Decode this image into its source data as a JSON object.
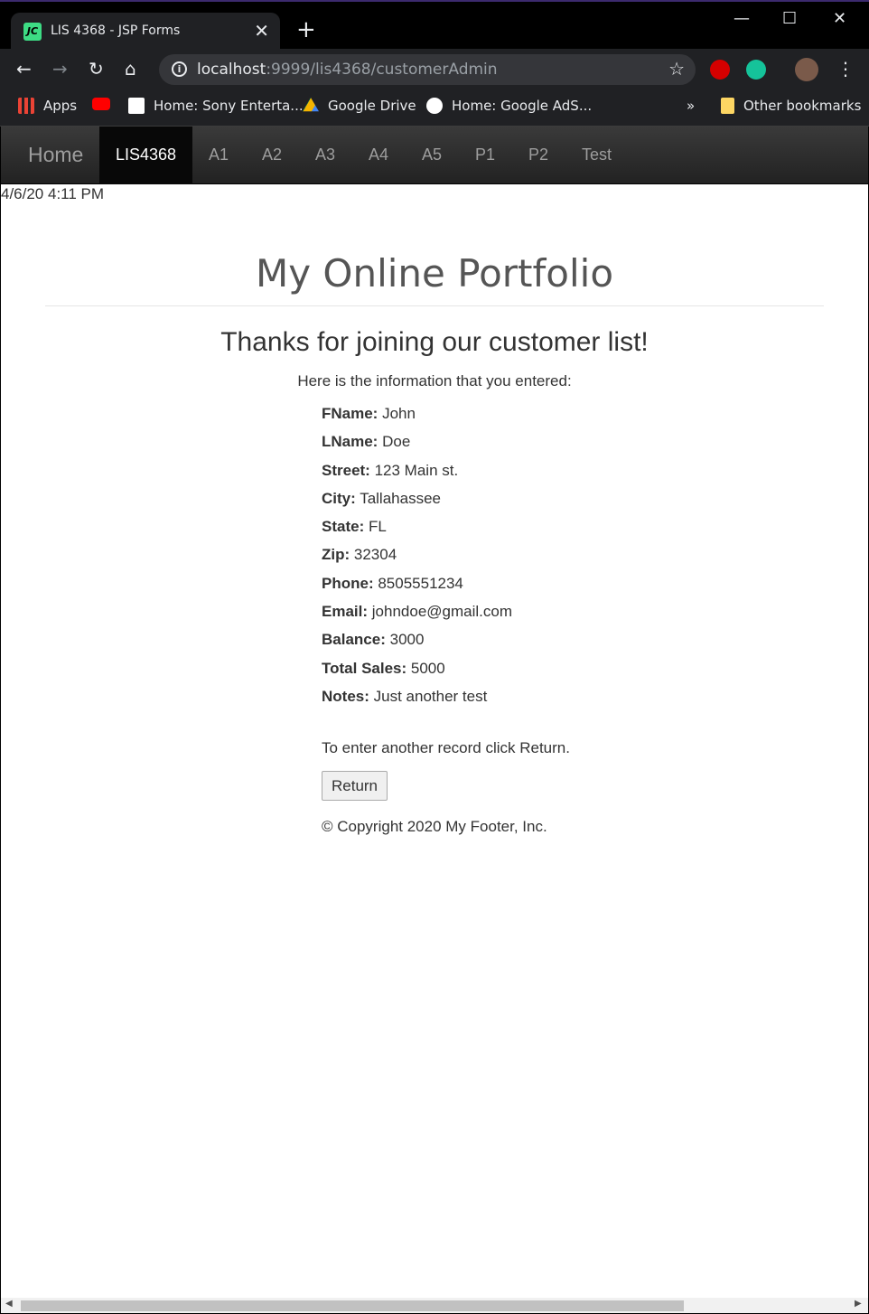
{
  "browser": {
    "tab_title": "LIS 4368 - JSP Forms",
    "tab_favicon_text": "JC",
    "url_host": "localhost",
    "url_path": ":9999/lis4368/customerAdmin",
    "bookmarks": [
      {
        "label": "Apps",
        "icon": "apps-grid-icon"
      },
      {
        "label": "",
        "icon": "youtube-icon"
      },
      {
        "label": "Home: Sony Enterta...",
        "icon": "sony-s-icon"
      },
      {
        "label": "Google Drive",
        "icon": "google-drive-icon"
      },
      {
        "label": "Home: Google AdS...",
        "icon": "google-g-icon"
      }
    ],
    "overflow_chevron": "»",
    "other_bookmarks": "Other bookmarks"
  },
  "nav": {
    "brand": "Home",
    "items": [
      "LIS4368",
      "A1",
      "A2",
      "A3",
      "A4",
      "A5",
      "P1",
      "P2",
      "Test"
    ],
    "active_item": "LIS4368"
  },
  "page": {
    "timestamp": "4/6/20 4:11 PM",
    "heading": "My Online Portfolio",
    "thanks": "Thanks for joining our customer list!",
    "intro": "Here is the information that you entered:",
    "fields": [
      {
        "label": "FName:",
        "value": "John"
      },
      {
        "label": "LName:",
        "value": "Doe"
      },
      {
        "label": "Street:",
        "value": "123 Main st."
      },
      {
        "label": "City:",
        "value": "Tallahassee"
      },
      {
        "label": "State:",
        "value": "FL"
      },
      {
        "label": "Zip:",
        "value": "32304"
      },
      {
        "label": "Phone:",
        "value": "8505551234"
      },
      {
        "label": "Email:",
        "value": "johndoe@gmail.com"
      },
      {
        "label": "Balance:",
        "value": "3000"
      },
      {
        "label": "Total Sales:",
        "value": "5000"
      },
      {
        "label": "Notes:",
        "value": "Just another test"
      }
    ],
    "return_text": "To enter another record click Return.",
    "return_button": "Return",
    "footer": "© Copyright 2020 My Footer, Inc."
  },
  "colors": {
    "navbar": "#222222",
    "nav_active": "#080808",
    "text": "#333333",
    "heading": "#555555"
  }
}
